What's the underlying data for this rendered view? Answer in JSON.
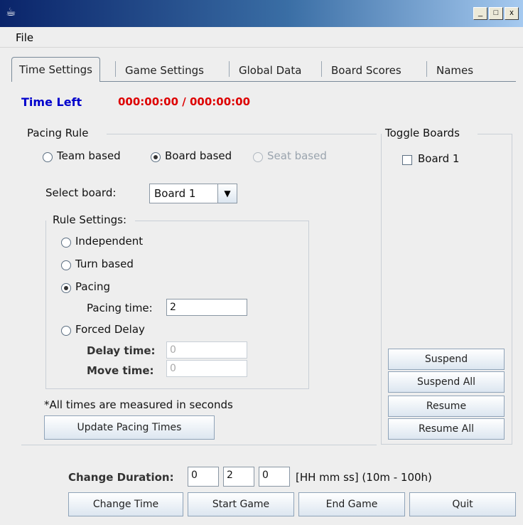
{
  "window": {
    "buttons": [
      "_",
      "□",
      "x"
    ]
  },
  "menu": {
    "file": "File"
  },
  "tabs": [
    "Time Settings",
    "Game Settings",
    "Global Data",
    "Board Scores",
    "Names"
  ],
  "time_left": {
    "label": "Time Left",
    "value": "000:00:00 / 000:00:00",
    "label_color": "#0000cc",
    "value_color": "#dd0000"
  },
  "pacing_rule": {
    "title": "Pacing Rule",
    "options": [
      "Team based",
      "Board based",
      "Seat based"
    ],
    "selected": "Board based",
    "select_board_label": "Select board:",
    "select_board_value": "Board 1"
  },
  "rule_settings": {
    "title": "Rule Settings:",
    "options": [
      "Independent",
      "Turn based",
      "Pacing",
      "Forced Delay"
    ],
    "selected": "Pacing",
    "pacing_time_label": "Pacing time:",
    "pacing_time_value": "2",
    "delay_time_label": "Delay time:",
    "delay_time_value": "0",
    "move_time_label": "Move time:",
    "move_time_value": "0"
  },
  "note": "*All times are measured in seconds",
  "update_button": "Update Pacing Times",
  "toggle_boards": {
    "title": "Toggle Boards",
    "boards": [
      "Board 1"
    ],
    "suspend": "Suspend",
    "suspend_all": "Suspend All",
    "resume": "Resume",
    "resume_all": "Resume All"
  },
  "duration": {
    "label": "Change Duration:",
    "hh": "0",
    "mm": "2",
    "ss": "0",
    "hint": "[HH mm ss] (10m - 100h)"
  },
  "bottom_buttons": [
    "Change Time",
    "Start Game",
    "End Game",
    "Quit"
  ]
}
